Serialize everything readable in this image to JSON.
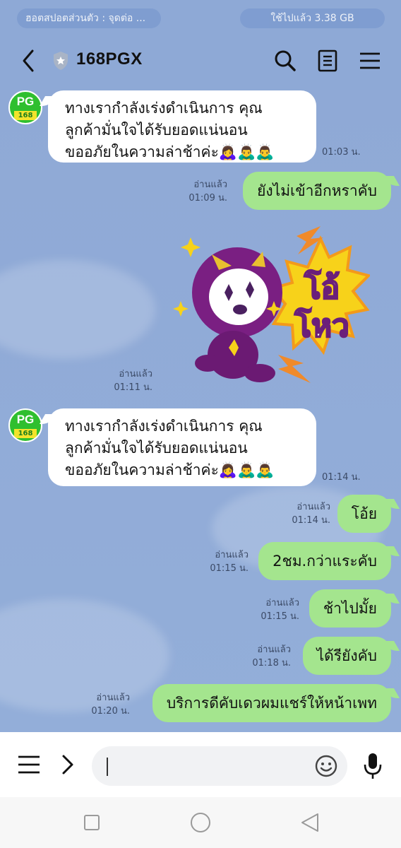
{
  "status_bar": {
    "left_text": "ฮอตสปอตส่วนตัว : จุดต่อ ...",
    "right_text": "ใช้ไปแล้ว 3.38 GB"
  },
  "header": {
    "title": "168PGX",
    "icons": [
      "back-icon",
      "shield-icon",
      "search-icon",
      "notes-icon",
      "menu-icon"
    ]
  },
  "avatar": {
    "line1": "PG",
    "line2": "168"
  },
  "messages": [
    {
      "side": "in",
      "lines": [
        "ทางเรากำลังเร่งดำเนินการ คุณ",
        "ลูกค้ามั่นใจได้รับยอดแน่นอน",
        "ขออภัยในความล่าช้าค่ะ🙇‍♀️🙇‍♂️🙇‍♂️"
      ],
      "time": "01:03 น."
    },
    {
      "side": "out",
      "text": "ยังไม่เข้าอีกหราคับ",
      "read": "อ่านแล้ว",
      "time": "01:09 น."
    },
    {
      "side": "out",
      "type": "sticker",
      "sticker_text_1": "โอ้",
      "sticker_text_2": "โหว",
      "read": "อ่านแล้ว",
      "time": "01:11 น."
    },
    {
      "side": "in",
      "lines": [
        "ทางเรากำลังเร่งดำเนินการ คุณ",
        "ลูกค้ามั่นใจได้รับยอดแน่นอน",
        "ขออภัยในความล่าช้าค่ะ🙇‍♀️🙇‍♂️🙇‍♂️"
      ],
      "time": "01:14 น."
    },
    {
      "side": "out",
      "text": "โอ้ย",
      "read": "อ่านแล้ว",
      "time": "01:14 น."
    },
    {
      "side": "out",
      "text": "2ชม.กว่าแระคับ",
      "read": "อ่านแล้ว",
      "time": "01:15 น."
    },
    {
      "side": "out",
      "text": "ช้าไปมั้ย",
      "read": "อ่านแล้ว",
      "time": "01:15 น."
    },
    {
      "side": "out",
      "text": "ได้รียังคับ",
      "read": "อ่านแล้ว",
      "time": "01:18 น."
    },
    {
      "side": "out",
      "text": "บริการดีคับเดวผมแชร์ให้หน้าเพท",
      "read": "อ่านแล้ว",
      "time": "01:20 น."
    }
  ],
  "input_bar": {
    "placeholder": "",
    "icons": [
      "hamburger-icon",
      "chevron-right-icon",
      "emoji-icon",
      "microphone-icon"
    ]
  },
  "nav_bar": {
    "icons": [
      "recent-apps-icon",
      "home-icon",
      "back-triangle-icon"
    ]
  },
  "colors": {
    "chat_background": "#8ea9d6",
    "outgoing_bubble": "#a4e58e",
    "incoming_bubble": "#ffffff"
  }
}
